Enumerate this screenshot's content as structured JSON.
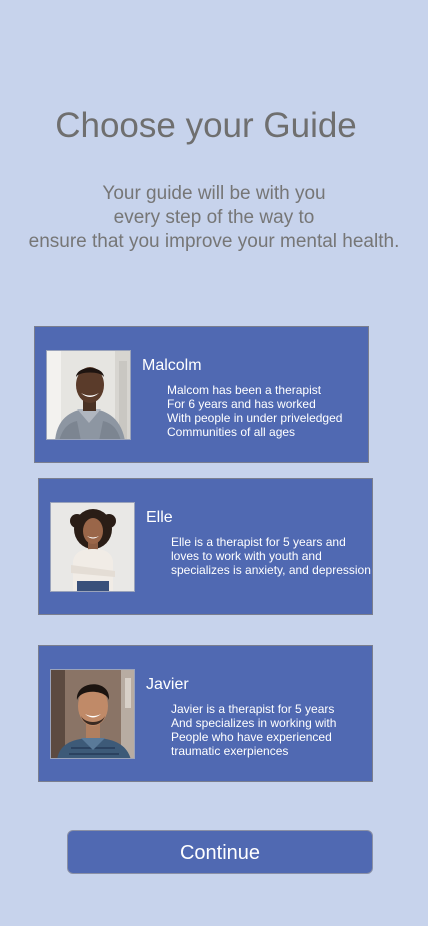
{
  "header": {
    "title": "Choose your Guide",
    "subtitle_lines": [
      "Your guide will be with you",
      "every step of the way to",
      "ensure that you improve your mental health."
    ]
  },
  "guides": [
    {
      "name": "Malcolm",
      "bio_lines": [
        "Malcom has been a therapist",
        "For 6 years and has worked",
        "With people in under priveledged",
        "Communities of all ages"
      ]
    },
    {
      "name": "Elle",
      "bio_lines": [
        "Elle is a therapist for 5 years and",
        "loves to work with youth and",
        "specializes is anxiety, and depression"
      ]
    },
    {
      "name": "Javier",
      "bio_lines": [
        "Javier is a therapist for 5 years",
        "And specializes in working with",
        "People who have experienced",
        "traumatic exerpiences"
      ]
    }
  ],
  "actions": {
    "continue_label": "Continue"
  },
  "colors": {
    "background": "#c7d3ec",
    "card": "#5069b2",
    "heading_text": "#6f6f6f"
  }
}
